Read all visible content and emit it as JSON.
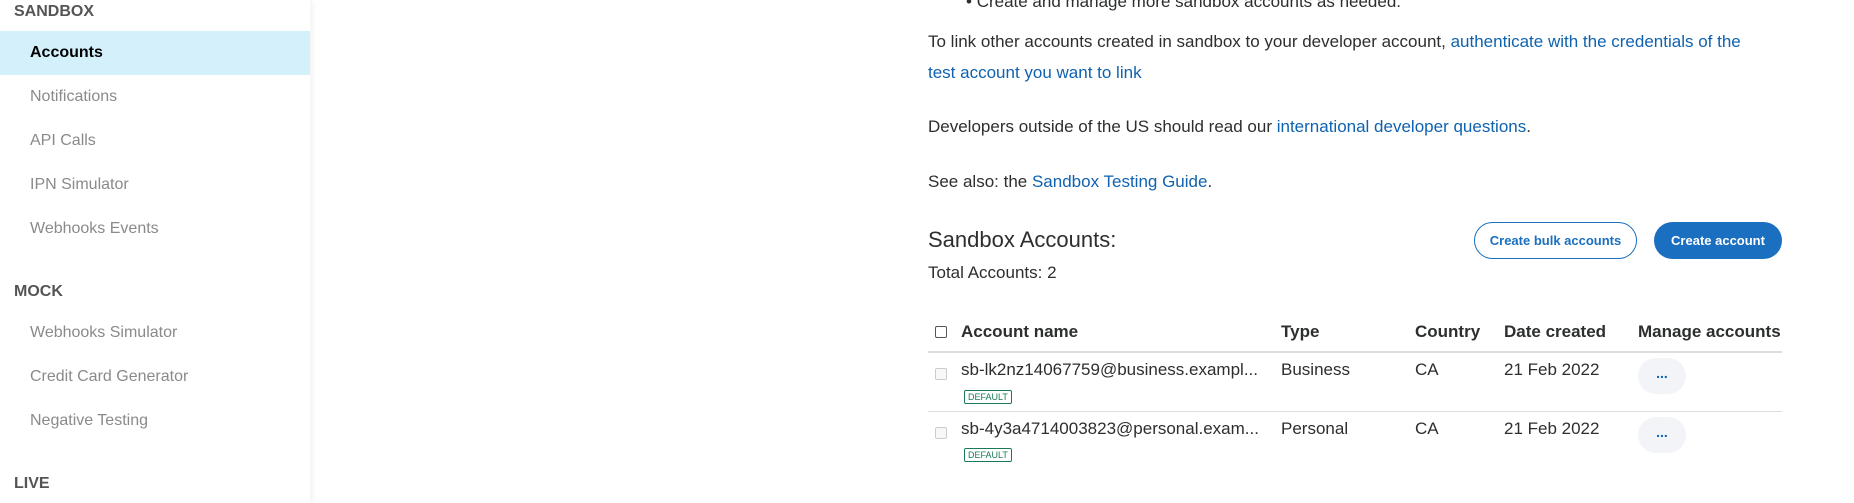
{
  "sidebar": {
    "sections": [
      {
        "title": "SANDBOX",
        "items": [
          "Accounts",
          "Notifications",
          "API Calls",
          "IPN Simulator",
          "Webhooks Events"
        ]
      },
      {
        "title": "MOCK",
        "items": [
          "Webhooks Simulator",
          "Credit Card Generator",
          "Negative Testing"
        ]
      },
      {
        "title": "LIVE",
        "items": []
      }
    ],
    "active": "Accounts"
  },
  "main": {
    "bullet": "Create and manage more sandbox accounts as needed.",
    "link_para": {
      "text": "To link other accounts created in sandbox to your developer account, ",
      "link1": "authenticate with the credentials of the",
      "link2": "test account you want to link"
    },
    "intl_para": {
      "text": "Developers outside of the US should read our ",
      "link": "international developer questions",
      "end": "."
    },
    "see_also": {
      "text": "See also: the ",
      "link": "Sandbox Testing Guide",
      "end": "."
    },
    "heading": "Sandbox Accounts:",
    "total": "Total Accounts: 2",
    "bulk_button": "Create bulk accounts",
    "create_button": "Create account",
    "colors": {
      "primary": "#1a6fc0",
      "link": "#0f62b0",
      "active_bg": "#d4f0fb",
      "badge": "#1a7a55"
    },
    "table": {
      "headers": [
        "Account name",
        "Type",
        "Country",
        "Date created",
        "Manage accounts"
      ],
      "rows": [
        {
          "name": "sb-lk2nz14067759@business.exampl...",
          "badge": "DEFAULT",
          "type": "Business",
          "country": "CA",
          "date": "21 Feb 2022",
          "manage": "..."
        },
        {
          "name": "sb-4y3a4714003823@personal.exam...",
          "badge": "DEFAULT",
          "type": "Personal",
          "country": "CA",
          "date": "21 Feb 2022",
          "manage": "..."
        }
      ]
    }
  }
}
